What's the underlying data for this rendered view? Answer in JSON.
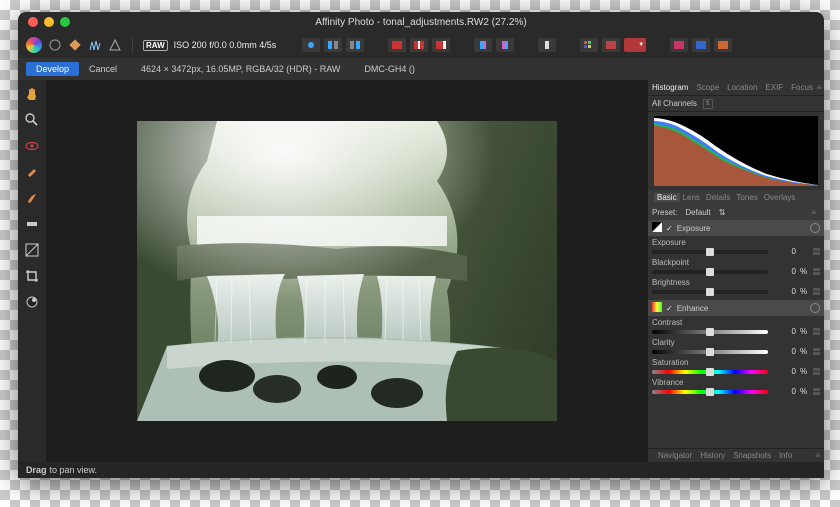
{
  "window": {
    "title": "Affinity Photo - tonal_adjustments.RW2 (27.2%)"
  },
  "toolbar": {
    "raw_badge": "RAW",
    "meta": "ISO 200  f/0.0  0.0mm  4/5s"
  },
  "secondbar": {
    "develop": "Develop",
    "cancel": "Cancel",
    "dims": "4624 × 3472px, 16.05MP, RGBA/32 (HDR) - RAW",
    "camera": "DMC-GH4 ()"
  },
  "panels": {
    "top_tabs": [
      "Histogram",
      "Scope",
      "Location",
      "EXIF",
      "Focus"
    ],
    "top_active": 0,
    "channels_label": "All Channels",
    "sub_tabs": [
      "Basic",
      "Lens",
      "Details",
      "Tones",
      "Overlays"
    ],
    "sub_active": 0,
    "preset_label": "Preset:",
    "preset_value": "Default",
    "exposure_section": {
      "title": "Exposure",
      "sliders": [
        {
          "label": "Exposure",
          "value": "0",
          "pos": 50,
          "unit": ""
        },
        {
          "label": "Blackpoint",
          "value": "0",
          "pos": 50,
          "unit": "%"
        },
        {
          "label": "Brightness",
          "value": "0",
          "pos": 50,
          "unit": "%"
        }
      ]
    },
    "enhance_section": {
      "title": "Enhance",
      "sliders": [
        {
          "label": "Contrast",
          "value": "0",
          "pos": 50,
          "unit": "%",
          "bar": "enh"
        },
        {
          "label": "Clarity",
          "value": "0",
          "pos": 50,
          "unit": "%",
          "bar": "enh"
        },
        {
          "label": "Saturation",
          "value": "0",
          "pos": 50,
          "unit": "%",
          "bar": "sat"
        },
        {
          "label": "Vibrance",
          "value": "0",
          "pos": 50,
          "unit": "%",
          "bar": "sat"
        }
      ]
    },
    "bottom_tabs": [
      "Navigator",
      "History",
      "Snapshots",
      "Info"
    ]
  },
  "status": {
    "bold": "Drag",
    "rest": "to pan view."
  },
  "tools": [
    "hand",
    "zoom",
    "eye",
    "redeye",
    "blemish",
    "overlaybrush",
    "gradient",
    "crop",
    "rotate"
  ]
}
